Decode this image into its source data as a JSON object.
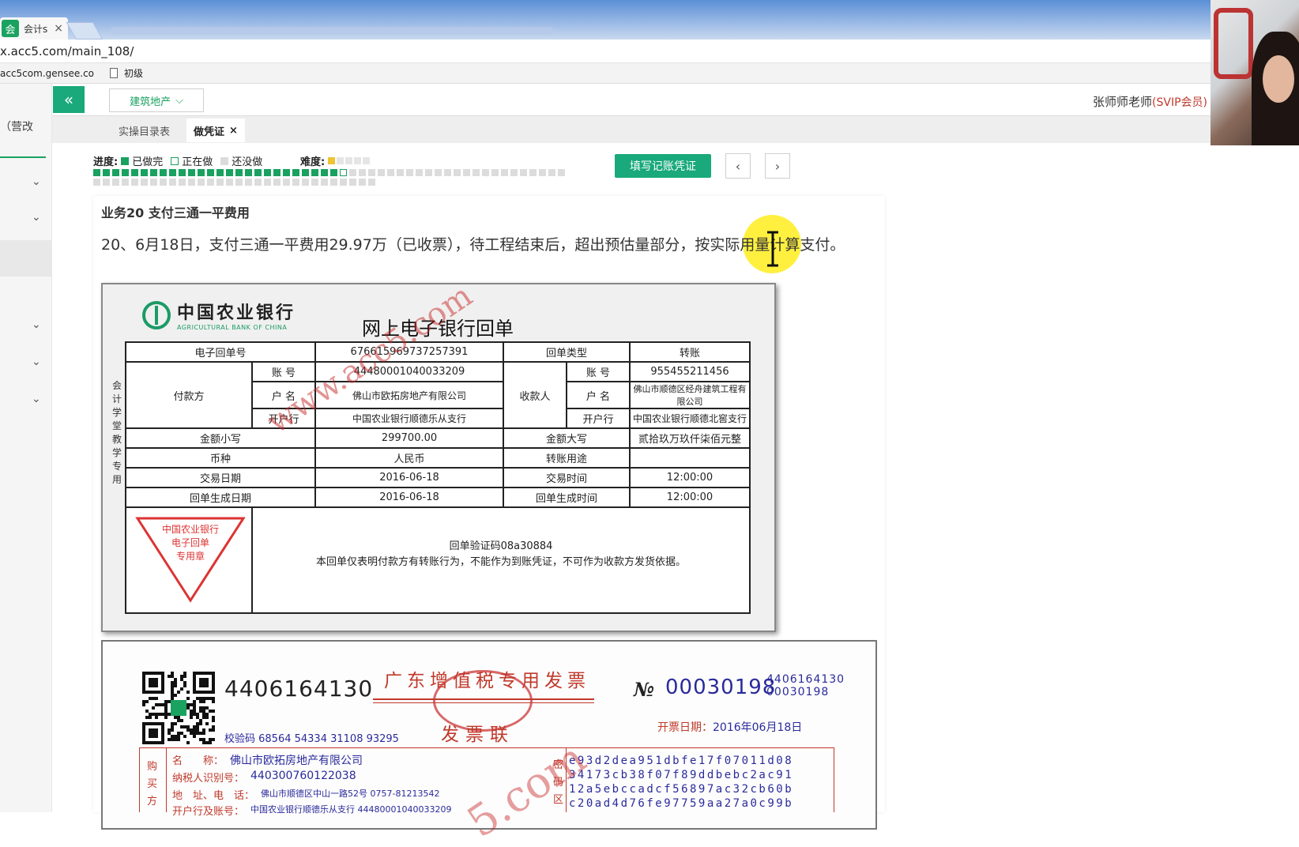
{
  "browser": {
    "tab_title": "会计s",
    "tab_close": "×",
    "url": "x.acc5.com/main_108/",
    "bookmarks": [
      "acc5com.gensee.co",
      "初级"
    ]
  },
  "sidebar": {
    "label": "（营改"
  },
  "header": {
    "collapse_icon": "«",
    "industry": "建筑地产",
    "teacher": "张师师老师",
    "vip": "(SVIP会员)"
  },
  "tabs": {
    "catalog": "实操目录表",
    "voucher": "做凭证",
    "close": "×"
  },
  "progress": {
    "label": "进度:",
    "done": "已做完",
    "doing": "正在做",
    "todo": "还没做",
    "done_count": 26,
    "total": 80,
    "colors": {
      "done": "#19a15f",
      "todo": "#dcdcdc"
    }
  },
  "difficulty": {
    "label": "难度:",
    "level": 1,
    "max": 5
  },
  "actions": {
    "fill_voucher": "填写记账凭证",
    "prev": "‹",
    "next": "›"
  },
  "business": {
    "title": "业务20 支付三通一平费用",
    "description": "20、6月18日，支付三通一平费用29.97万（已收票），待工程结束后，超出预估量部分，按实际用量计算支付。"
  },
  "receipt": {
    "bank_cn": "中国农业银行",
    "bank_en": "AGRICULTURAL BANK OF CHINA",
    "title": "网上电子银行回单",
    "side_text": "会计学堂教学专用",
    "labels": {
      "receipt_no": "电子回单号",
      "receipt_type": "回单类型",
      "payer": "付款方",
      "payee": "收款人",
      "account": "账 号",
      "name": "户 名",
      "bank": "开户行",
      "amount_small": "金额小写",
      "amount_big": "金额大写",
      "currency": "币种",
      "purpose": "转账用途",
      "trade_date": "交易日期",
      "trade_time": "交易时间",
      "gen_date": "回单生成日期",
      "gen_time": "回单生成时间"
    },
    "values": {
      "receipt_no": "676615969737257391",
      "receipt_type": "转账",
      "payer_account": "44480001040033209",
      "payer_name": "佛山市欧拓房地产有限公司",
      "payer_bank": "中国农业银行顺德乐从支行",
      "payee_account": "955455211456",
      "payee_name": "佛山市顺德区经舟建筑工程有限公司",
      "payee_bank": "中国农业银行顺德北窖支行",
      "amount_small": "299700.00",
      "amount_big": "贰拾玖万玖仟柒佰元整",
      "currency": "人民币",
      "purpose": "",
      "trade_date": "2016-06-18",
      "trade_time": "12:00:00",
      "gen_date": "2016-06-18",
      "gen_time": "12:00:00"
    },
    "stamp": [
      "中国农业银行",
      "电子回单",
      "专用章"
    ],
    "verify_code": "回单验证码08a30884",
    "note": "本回单仅表明付款方有转账行为，不能作为到账凭证，不可作为收款方发货依据。",
    "watermark": "www.acc5.com"
  },
  "invoice": {
    "code": "4406164130",
    "check_code": "校验码 68564 54334 31108 93295",
    "title": "广东增值税专用发票",
    "subtitle": "发票联",
    "no_label": "№",
    "number": "00030198",
    "code_small": "4406164130",
    "number_small": "00030198",
    "date_label": "开票日期：",
    "date": "2016年06月18日",
    "buyer_side": "购买方",
    "buyer_labels": [
      "名　　称：",
      "纳税人识别号：",
      "地　址、电　话：",
      "开户行及账号："
    ],
    "buyer_values": [
      "佛山市欧拓房地产有限公司",
      "440300760122038",
      "佛山市顺德区中山一路52号 0757-81213542",
      "中国农业银行顺德乐从支行 44480001040033209"
    ],
    "cipher_side": "密码区",
    "cipher_lines": [
      "e93d2dea951dbfe17f07011d08",
      "34173cb38f07f89ddbebc2ac91",
      "12a5ebccadcf56897ac32cb60b",
      "c20ad4d76fe97759aa27a0c99b"
    ],
    "watermark": "5.com"
  }
}
